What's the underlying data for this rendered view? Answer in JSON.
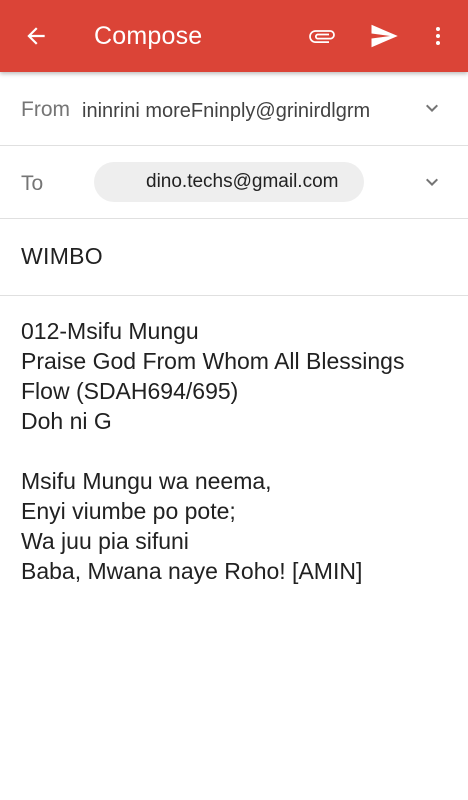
{
  "header": {
    "title": "Compose",
    "background": "#db4437",
    "icons": {
      "back": "arrow-back-icon",
      "attach": "paperclip-icon",
      "send": "send-icon",
      "more": "more-vert-icon"
    }
  },
  "from": {
    "label": "From",
    "value": "ininrini   moreFninply@grinirdlgrm"
  },
  "to": {
    "label": "To",
    "chip": "dino.techs@gmail.com"
  },
  "subject": {
    "value": "WIMBO"
  },
  "body": {
    "lines": [
      "012-Msifu Mungu",
      "Praise God From Whom All Blessings",
      "Flow (SDAH694/695)",
      "Doh ni G",
      "",
      "Msifu Mungu wa neema,",
      "Enyi viumbe po pote;",
      "Wa juu pia sifuni",
      "Baba, Mwana naye Roho! [AMIN]"
    ]
  }
}
